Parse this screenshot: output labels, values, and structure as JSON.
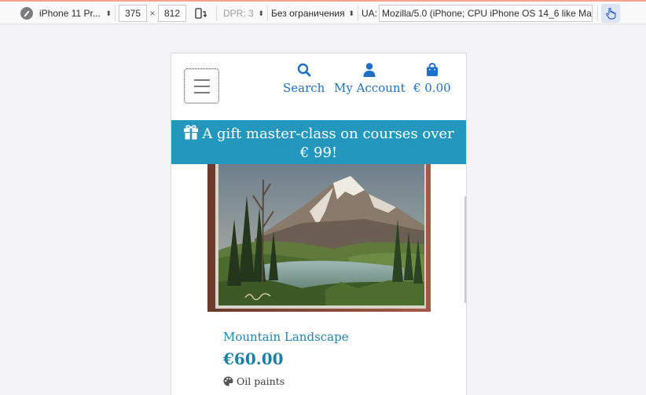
{
  "devtools": {
    "device": "iPhone 11 Pr...",
    "width": "375",
    "times": "×",
    "height": "812",
    "dpr": "DPR: 3",
    "throttling": "Без ограничения",
    "ua_label": "UA:",
    "user_agent": "Mozilla/5.0 (iPhone; CPU iPhone OS 14_6 like Mac"
  },
  "header": {
    "nav": {
      "search": "Search",
      "account": "My Account",
      "cart": "€ 0.00"
    },
    "accent_color": "#1e6fc8"
  },
  "promo": {
    "text_line1": "A gift master-class on courses over",
    "text_line2": "€ 99!",
    "bg_color": "#2397bd"
  },
  "product": {
    "name": "Mountain Landscape",
    "price": "€60.00",
    "category": "Oil paints",
    "name_color": "#2085b0"
  }
}
